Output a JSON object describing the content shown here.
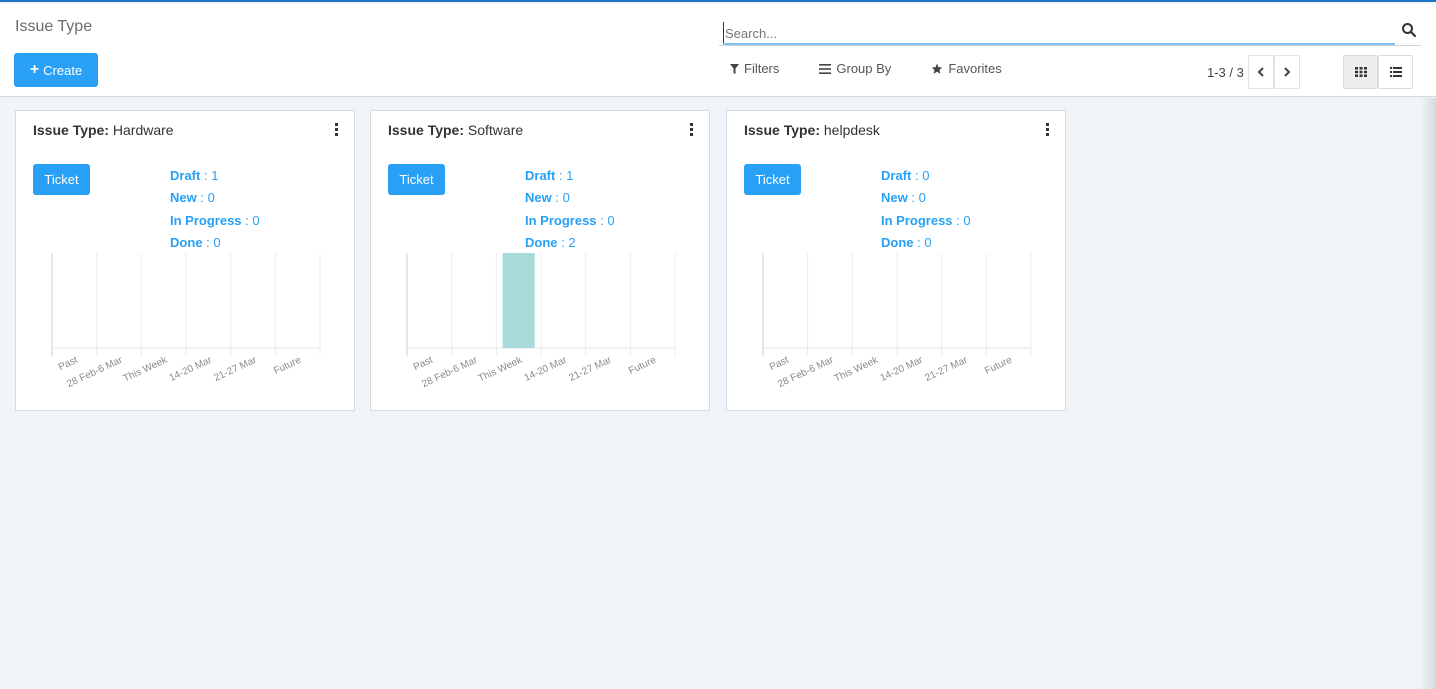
{
  "header": {
    "breadcrumb": "Issue Type",
    "create_label": "Create",
    "create_icon": "plus-icon",
    "search": {
      "placeholder": "Search...",
      "value": "",
      "icon": "search-icon"
    },
    "filters_label": "Filters",
    "group_by_label": "Group By",
    "favorites_label": "Favorites",
    "pager": "1-3 / 3",
    "views": [
      {
        "name": "kanban",
        "icon": "grid-icon",
        "active": true
      },
      {
        "name": "list",
        "icon": "list-icon",
        "active": false
      }
    ]
  },
  "colors": {
    "primary": "#27a0f5",
    "bar": "#a8dad9",
    "top_accent": "#1f74c4",
    "background": "#f0f5fa"
  },
  "cards": [
    {
      "title_label": "Issue Type:",
      "title_value": "Hardware",
      "button": "Ticket",
      "stats": [
        {
          "label": "Draft",
          "value": "1"
        },
        {
          "label": "New",
          "value": "0"
        },
        {
          "label": "In Progress",
          "value": "0"
        },
        {
          "label": "Done",
          "value": "0"
        }
      ]
    },
    {
      "title_label": "Issue Type:",
      "title_value": "Software",
      "button": "Ticket",
      "stats": [
        {
          "label": "Draft",
          "value": "1"
        },
        {
          "label": "New",
          "value": "0"
        },
        {
          "label": "In Progress",
          "value": "0"
        },
        {
          "label": "Done",
          "value": "2"
        }
      ]
    },
    {
      "title_label": "Issue Type:",
      "title_value": "helpdesk",
      "button": "Ticket",
      "stats": [
        {
          "label": "Draft",
          "value": "0"
        },
        {
          "label": "New",
          "value": "0"
        },
        {
          "label": "In Progress",
          "value": "0"
        },
        {
          "label": "Done",
          "value": "0"
        }
      ]
    }
  ],
  "chart_data": [
    {
      "type": "bar",
      "title": "Hardware",
      "categories": [
        "Past",
        "28 Feb-6 Mar",
        "This Week",
        "14-20 Mar",
        "21-27 Mar",
        "Future"
      ],
      "values": [
        0,
        0,
        0,
        0,
        0,
        0
      ],
      "xlabel": "",
      "ylabel": "",
      "ylim": [
        0,
        2
      ],
      "grid": true
    },
    {
      "type": "bar",
      "title": "Software",
      "categories": [
        "Past",
        "28 Feb-6 Mar",
        "This Week",
        "14-20 Mar",
        "21-27 Mar",
        "Future"
      ],
      "values": [
        0,
        0,
        2,
        0,
        0,
        0
      ],
      "xlabel": "",
      "ylabel": "",
      "ylim": [
        0,
        2
      ],
      "grid": true
    },
    {
      "type": "bar",
      "title": "helpdesk",
      "categories": [
        "Past",
        "28 Feb-6 Mar",
        "This Week",
        "14-20 Mar",
        "21-27 Mar",
        "Future"
      ],
      "values": [
        0,
        0,
        0,
        0,
        0,
        0
      ],
      "xlabel": "",
      "ylabel": "",
      "ylim": [
        0,
        2
      ],
      "grid": true
    }
  ]
}
